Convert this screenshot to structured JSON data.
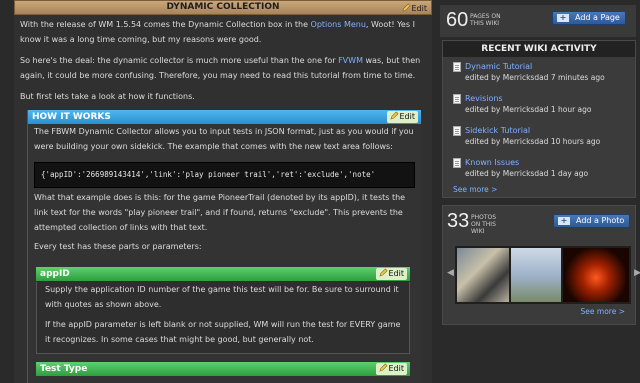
{
  "main": {
    "title": "DYNAMIC COLLECTION",
    "edit_label": "Edit",
    "intro_1a": "With the release of WM 1.5.54 comes the Dynamic Collection box in the ",
    "intro_1_link": "Options Menu",
    "intro_1b": ", Woot! Yes I know it was a long time coming, but my reasons were good.",
    "intro_2a": "So here's the deal: the dynamic collector is much more useful than the one for ",
    "intro_2_link": "FVWM",
    "intro_2b": " was, but then again, it could be more confusing. Therefore, you may need to read this tutorial from time to time.",
    "intro_3": "But first lets take a look at how it functions.",
    "how": {
      "title": "HOW IT WORKS",
      "edit_label": "Edit",
      "p1": "The FBWM Dynamic Collector allows you to input tests in JSON format, just as you would if you were building your own sidekick. The example that comes with the new text area follows:",
      "code": "{'appID':'266989143414','link':'play pioneer trail','ret':'exclude','note'",
      "p2": "What that example does is this: for the game PioneerTrail (denoted by its appID), it tests the link text for the words \"play pioneer trail\", and if found, returns \"exclude\". This prevents the attempted collection of links with that text.",
      "p3": "Every test has these parts or parameters:"
    },
    "appid": {
      "title": "appID",
      "edit_label": "Edit",
      "p1": "Supply the application ID number of the game this test will be for. Be sure to surround it with quotes as shown above.",
      "p2": "If the appID parameter is left blank or not supplied, WM will run the test for EVERY game it recognizes. In some cases that might be good, but generally not."
    },
    "testtype": {
      "title": "Test Type",
      "edit_label": "Edit"
    }
  },
  "sidebar": {
    "pages": {
      "count": "60",
      "caption_1": "PAGES ON",
      "caption_2": "THIS WIKI",
      "button": "Add a Page"
    },
    "activity": {
      "title": "RECENT WIKI ACTIVITY",
      "items": [
        {
          "title": "Dynamic Tutorial",
          "sub": "edited by Merricksdad 7 minutes ago"
        },
        {
          "title": "Revisions",
          "sub": "edited by Merricksdad 1 hour ago"
        },
        {
          "title": "Sidekick Tutorial",
          "sub": "edited by Merricksdad 10 hours ago"
        },
        {
          "title": "Known Issues",
          "sub": "edited by Merricksdad 1 day ago"
        }
      ],
      "see_more": "See more >"
    },
    "photos": {
      "count": "33",
      "caption_1": "PHOTOS",
      "caption_2": "ON THIS",
      "caption_3": "WIKI",
      "button": "Add a Photo",
      "see_more": "See more >"
    }
  }
}
